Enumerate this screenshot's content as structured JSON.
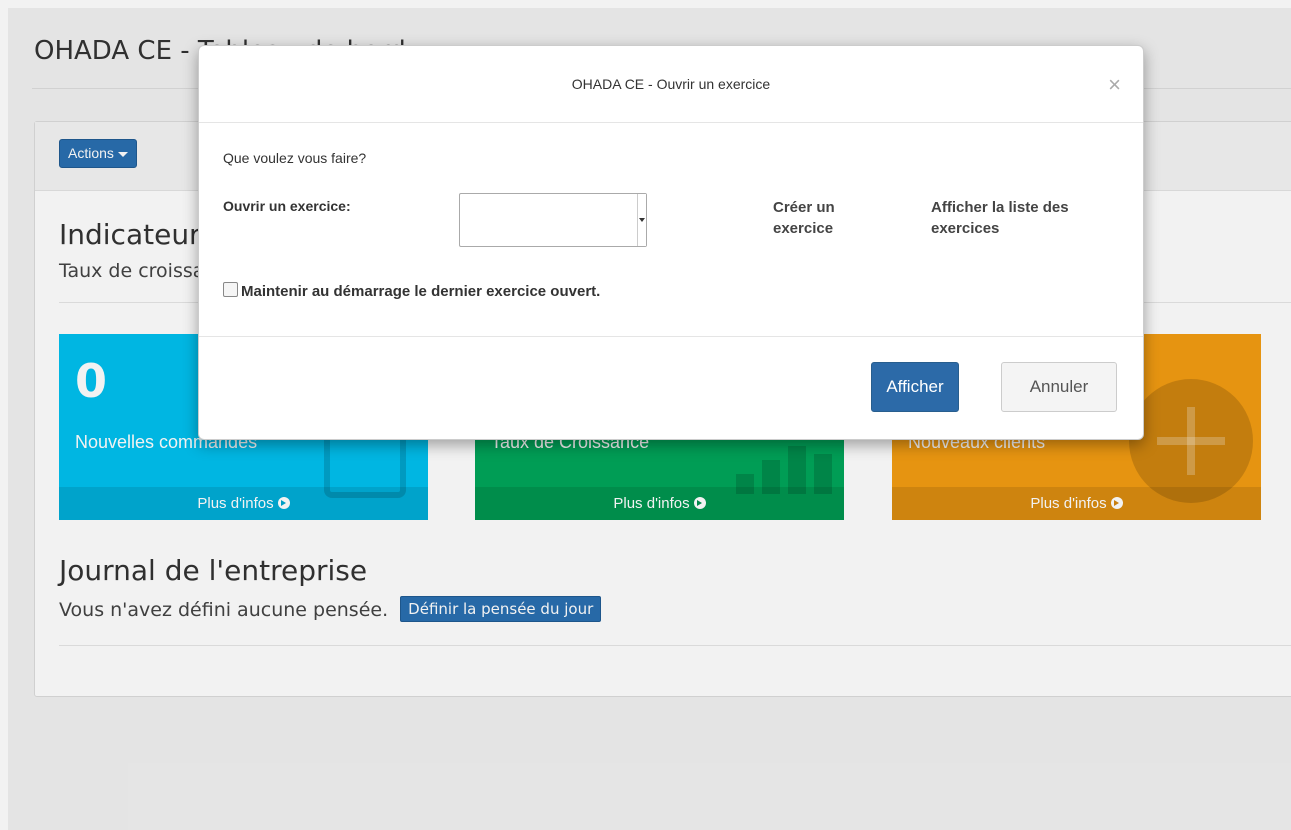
{
  "page": {
    "title": "OHADA CE - Tableau de bord"
  },
  "panel": {
    "actions_label": "Actions",
    "indicators_title": "Indicateurs",
    "indicators_subtitle": "Taux de croissance"
  },
  "boxes": [
    {
      "value": "0",
      "label": "Nouvelles commandes",
      "more": "Plus d'infos",
      "icon": "shopping-bag-icon",
      "color": "#00c0ef"
    },
    {
      "value": "",
      "label": "Taux de Croissance",
      "more": "Plus d'infos",
      "icon": "bar-chart-icon",
      "color": "#00a65a"
    },
    {
      "value": "",
      "label": "Nouveaux clients",
      "more": "Plus d'infos",
      "icon": "plus-circle-icon",
      "color": "#f39c12"
    }
  ],
  "journal": {
    "title": "Journal de l'entreprise",
    "text": "Vous n'avez défini aucune pensée.",
    "button": "Définir la pensée du jour"
  },
  "modal": {
    "title": "OHADA CE - Ouvrir un exercice",
    "close": "×",
    "question": "Que voulez vous faire?",
    "open_label": "Ouvrir un exercice:",
    "select_value": "",
    "create_link": "Créer un exercice",
    "list_link": "Afficher la liste des exercices",
    "keep_label": "Maintenir au démarrage le dernier exercice ouvert.",
    "btn_show": "Afficher",
    "btn_cancel": "Annuler"
  }
}
